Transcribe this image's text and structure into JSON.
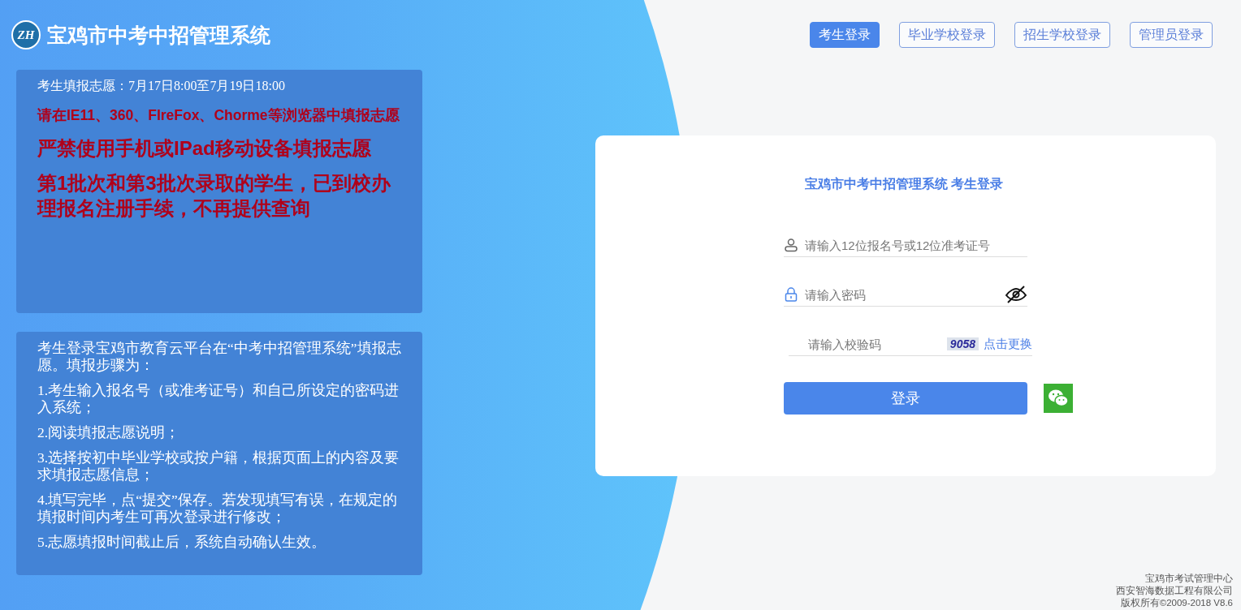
{
  "header": {
    "logo_text": "ZH",
    "title": "宝鸡市中考中招管理系统"
  },
  "tabs": [
    {
      "label": "考生登录",
      "selected": true
    },
    {
      "label": "毕业学校登录",
      "selected": false
    },
    {
      "label": "招生学校登录",
      "selected": false
    },
    {
      "label": "管理员登录",
      "selected": false
    }
  ],
  "notice": [
    {
      "kind": "plain",
      "text": "考生填报志愿：7月17日8:00至7月19日18:00"
    },
    {
      "kind": "warning",
      "text": "请在IE11、360、FIreFox、Chorme等浏览器中填报志愿"
    },
    {
      "kind": "alert",
      "text": "严禁使用手机或IPad移动设备填报志愿"
    },
    {
      "kind": "alert",
      "text": "第1批次和第3批次录取的学生，已到校办理报名注册手续，不再提供查询"
    }
  ],
  "instructions": [
    "考生登录宝鸡市教育云平台在“中考中招管理系统”填报志愿。填报步骤为：",
    "1.考生输入报名号（或准考证号）和自己所设定的密码进入系统；",
    "2.阅读填报志愿说明；",
    "3.选择按初中毕业学校或按户籍，根据页面上的内容及要求填报志愿信息；",
    "4.填写完毕，点“提交”保存。若发现填写有误，在规定的填报时间内考生可再次登录进行修改；",
    "5.志愿填报时间截止后，系统自动确认生效。"
  ],
  "login": {
    "title": "宝鸡市中考中招管理系统 考生登录",
    "fields": [
      {
        "kind": "user",
        "placeholder": "请输入12位报名号或12位准考证号"
      },
      {
        "kind": "password",
        "placeholder": "请输入密码"
      },
      {
        "kind": "captcha",
        "placeholder": "请输入校验码",
        "captcha": "9058",
        "refresh": "点击更换"
      }
    ],
    "button": "登录"
  },
  "footer": [
    "宝鸡市考试管理中心",
    "西安智海数据工程有限公司",
    "版权所有©2009-2018 V8.6"
  ]
}
